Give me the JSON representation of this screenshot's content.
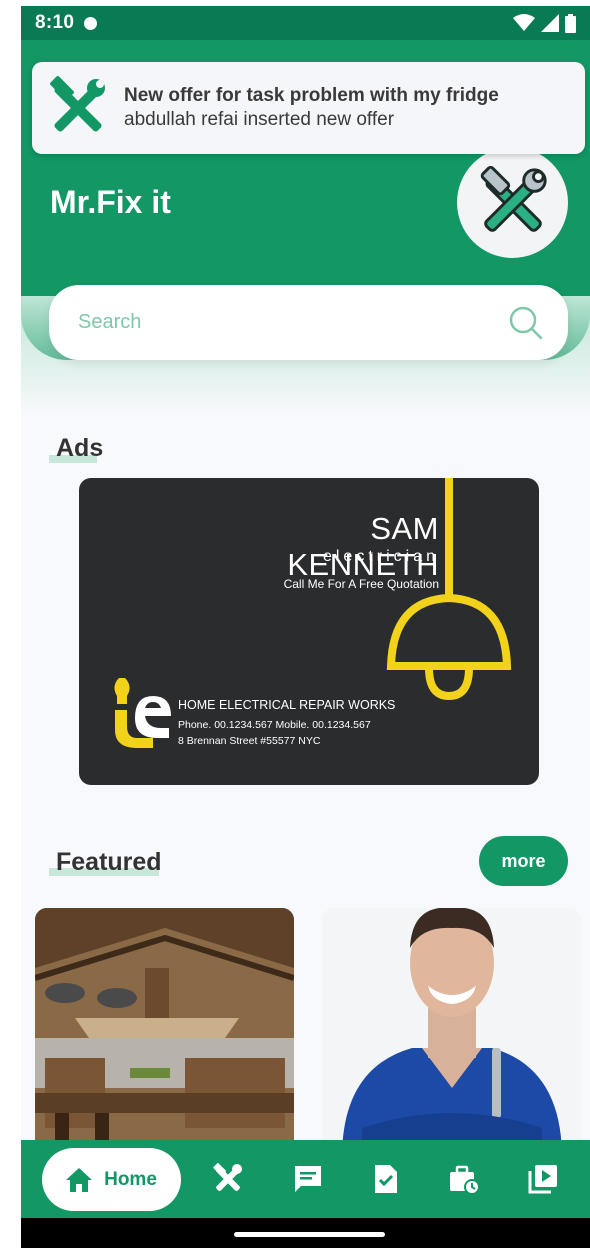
{
  "status_bar": {
    "time": "8:10"
  },
  "notification": {
    "title": "New offer for task problem with my fridge",
    "body": "abdullah refai inserted new offer"
  },
  "header": {
    "app_name": "Mr.Fix it"
  },
  "search": {
    "placeholder": "Search"
  },
  "ads": {
    "title": "Ads",
    "card": {
      "name": "SAM KENNETH",
      "role": "electrician",
      "cta": "Call Me For A Free Quotation",
      "company": "HOME ELECTRICAL REPAIR WORKS",
      "phone": "Phone. 00.1234.567 Mobile. 00.1234.567",
      "address": "8 Brennan Street #55577 NYC"
    }
  },
  "featured": {
    "title": "Featured",
    "more_label": "more"
  },
  "bottom_nav": {
    "home_label": "Home"
  },
  "colors": {
    "primary": "#129765",
    "primary_dark": "#0a7a55",
    "accent_yellow": "#f2d21b",
    "ad_background": "#2b2c2e"
  }
}
